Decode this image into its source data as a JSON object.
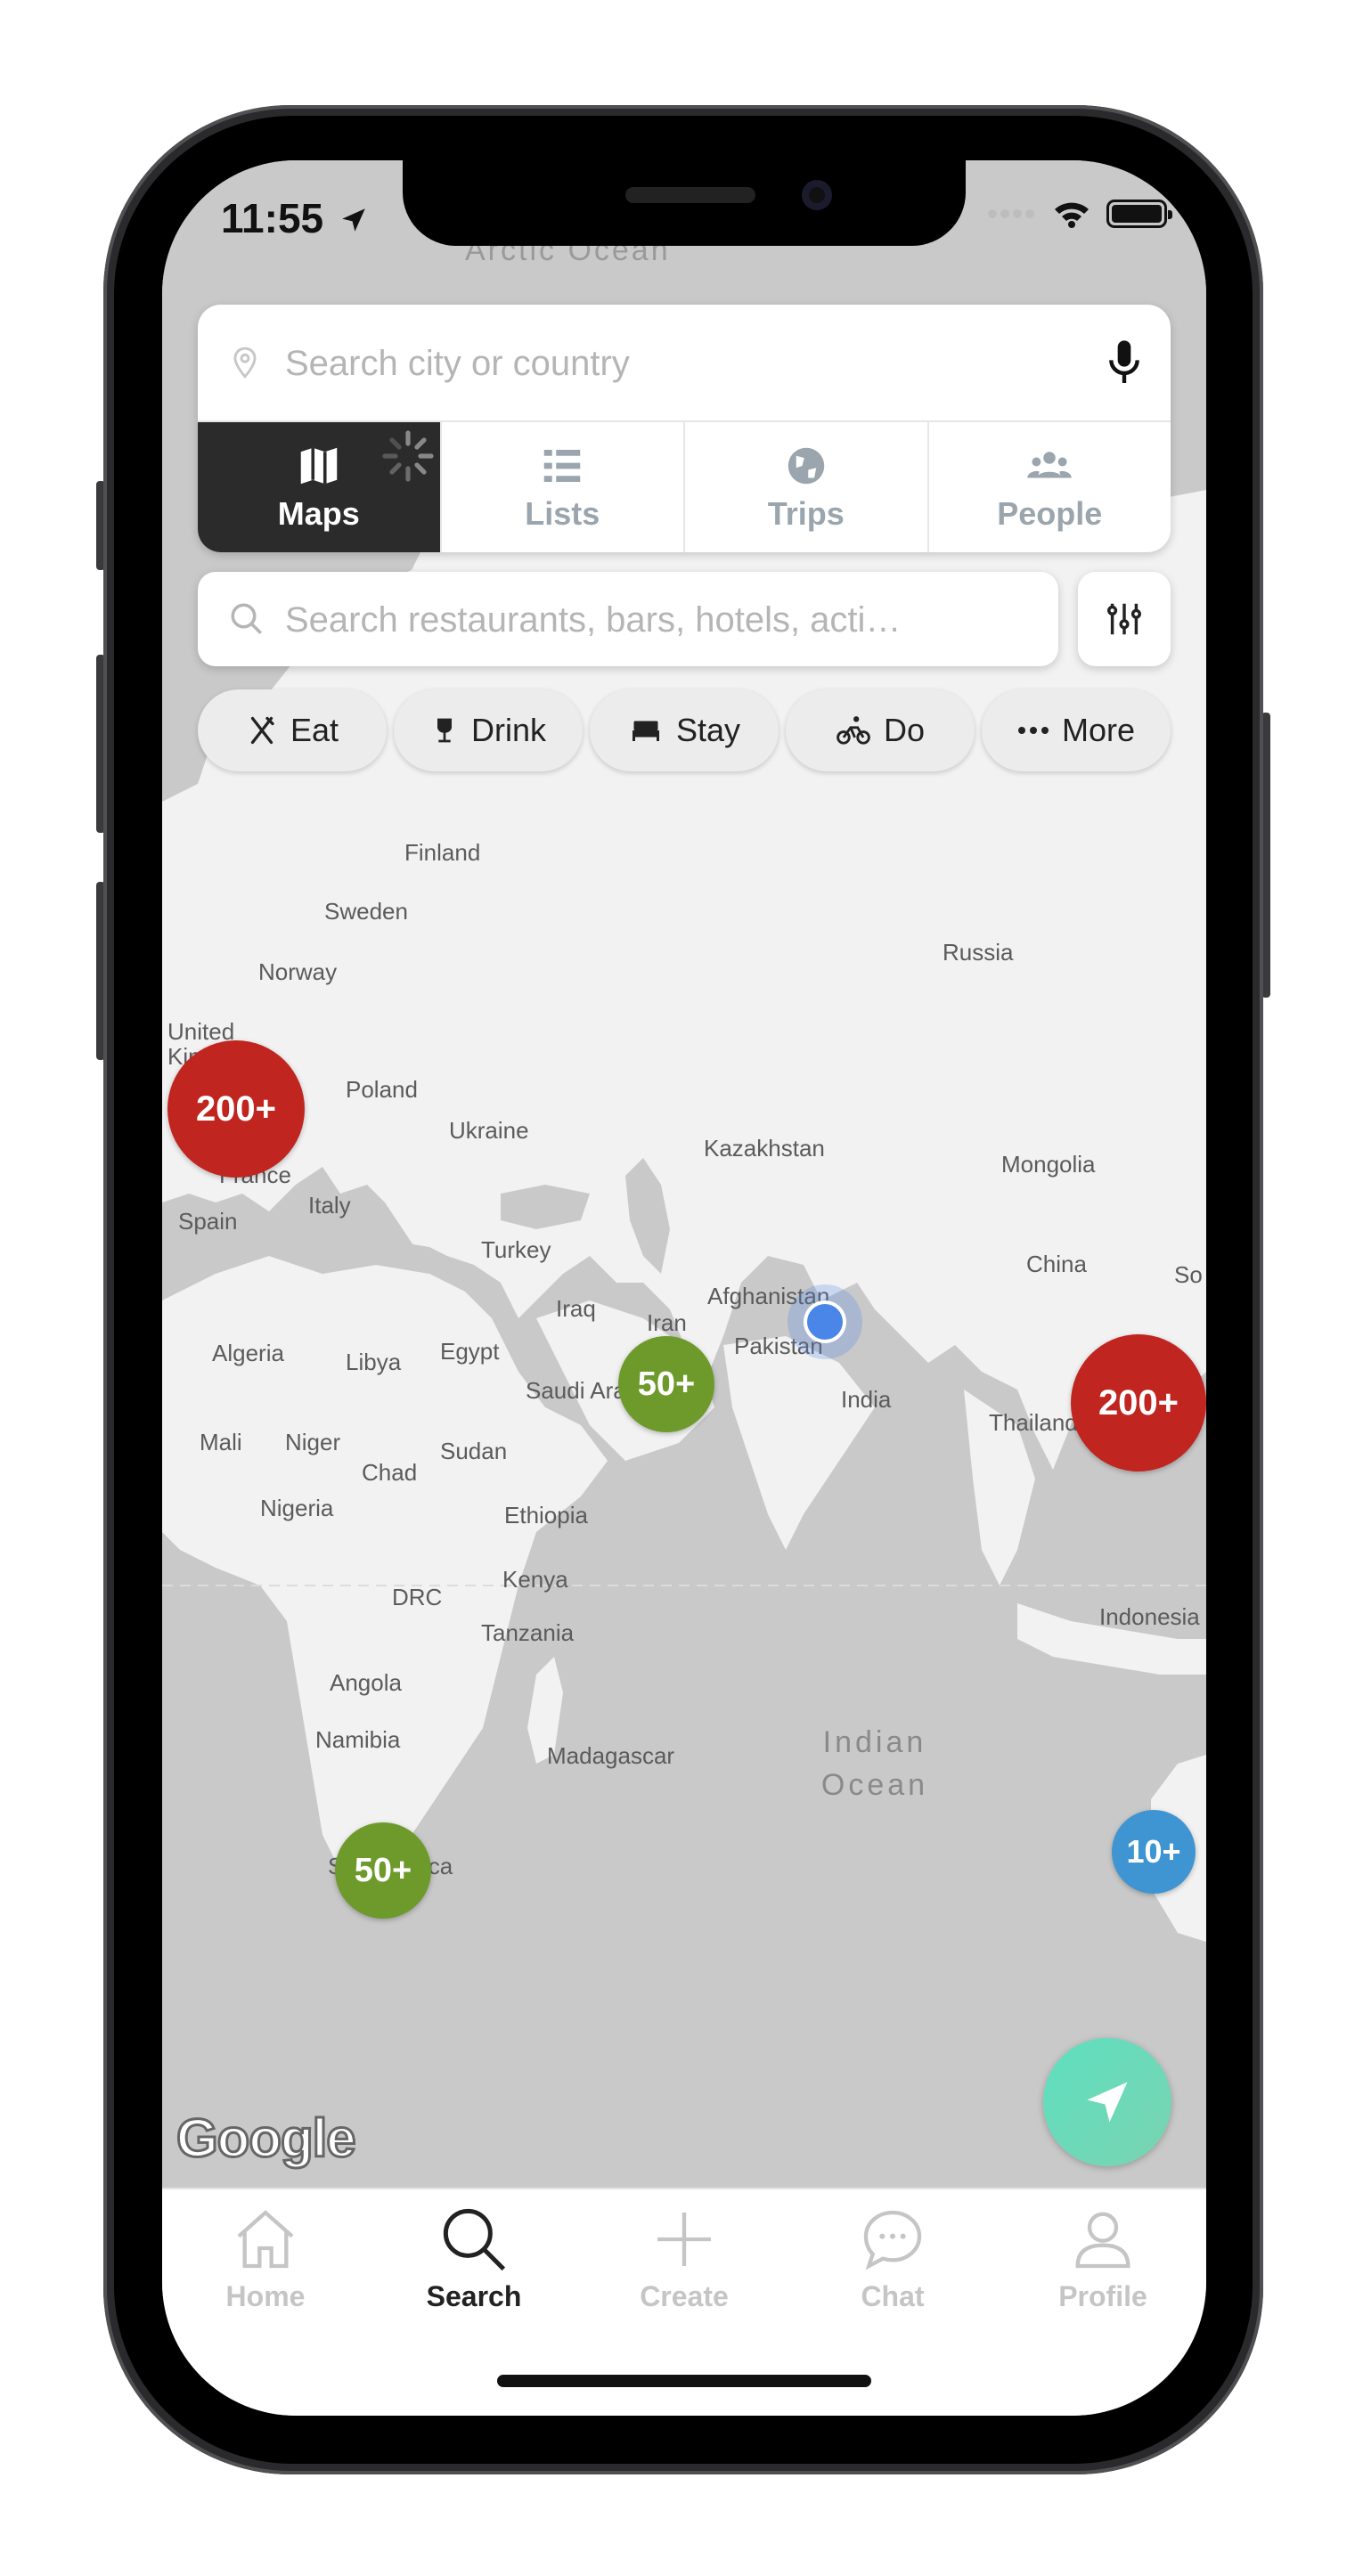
{
  "status_bar": {
    "time": "11:55"
  },
  "search": {
    "city_placeholder": "Search city or country",
    "poi_placeholder": "Search restaurants, bars, hotels, acti…"
  },
  "view_tabs": [
    {
      "label": "Maps",
      "icon": "map-icon",
      "active": true
    },
    {
      "label": "Lists",
      "icon": "list-icon",
      "active": false
    },
    {
      "label": "Trips",
      "icon": "globe-icon",
      "active": false
    },
    {
      "label": "People",
      "icon": "people-icon",
      "active": false
    }
  ],
  "categories": [
    {
      "label": "Eat",
      "icon": "fork-knife-icon"
    },
    {
      "label": "Drink",
      "icon": "wine-glass-icon"
    },
    {
      "label": "Stay",
      "icon": "bed-icon"
    },
    {
      "label": "Do",
      "icon": "bicycle-icon"
    },
    {
      "label": "More",
      "icon": "more-dots-icon"
    }
  ],
  "map": {
    "ocean_labels": [
      "Arctic Ocean",
      "Indian Ocean"
    ],
    "country_labels": [
      "Finland",
      "Sweden",
      "Russia",
      "Norway",
      "United Kingdom",
      "Poland",
      "Ukraine",
      "Kazakhstan",
      "Mongolia",
      "France",
      "Italy",
      "Spain",
      "Turkey",
      "China",
      "Iraq",
      "Iran",
      "Afghanistan",
      "Algeria",
      "Libya",
      "Egypt",
      "Pakistan",
      "Saudi Arabia",
      "India",
      "Thailand",
      "Mali",
      "Niger",
      "Chad",
      "Sudan",
      "Nigeria",
      "Ethiopia",
      "DRC",
      "Kenya",
      "Tanzania",
      "Indonesia",
      "Angola",
      "Namibia",
      "Madagascar",
      "South Africa",
      "So"
    ],
    "clusters": [
      {
        "label": "200+",
        "color": "#c0251f"
      },
      {
        "label": "50+",
        "color": "#6e9a2c"
      },
      {
        "label": "200+",
        "color": "#c0251f"
      },
      {
        "label": "50+",
        "color": "#6e9a2c"
      },
      {
        "label": "10+",
        "color": "#3f95d1"
      }
    ],
    "attribution": "Google"
  },
  "bottom_nav": [
    {
      "label": "Home",
      "icon": "home-icon",
      "active": false
    },
    {
      "label": "Search",
      "icon": "search-icon",
      "active": true
    },
    {
      "label": "Create",
      "icon": "plus-icon",
      "active": false
    },
    {
      "label": "Chat",
      "icon": "chat-icon",
      "active": false
    },
    {
      "label": "Profile",
      "icon": "profile-icon",
      "active": false
    }
  ],
  "colors": {
    "active_tab": "#2b2b2b",
    "inactive_tab_text": "#9aa5ad",
    "locate_button": "#6ddbb8",
    "user_location": "#4a86e8"
  }
}
